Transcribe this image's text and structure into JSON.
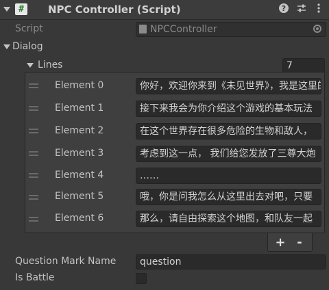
{
  "header": {
    "title": "NPC Controller (Script)",
    "script_icon_glyph": "#",
    "help_icon": "question-circle-icon",
    "preset_icon": "sliders-icon",
    "menu_icon": "kebab-menu-icon"
  },
  "script_field": {
    "label": "Script",
    "value": "NPCController"
  },
  "dialog": {
    "label": "Dialog",
    "lines": {
      "label": "Lines",
      "size": "7",
      "elements": [
        {
          "label": "Element 0",
          "value": "你好，欢迎你来到《未见世界》，我是这里的向导"
        },
        {
          "label": "Element 1",
          "value": "接下来我会为你介绍这个游戏的基本玩法"
        },
        {
          "label": "Element 2",
          "value": "在这个世界存在很多危险的生物和敌人，"
        },
        {
          "label": "Element 3",
          "value": "考虑到这一点， 我们给您发放了三尊大炮"
        },
        {
          "label": "Element 4",
          "value": "……"
        },
        {
          "label": "Element 5",
          "value": "哦，你是问我怎么从这里出去对吧，只要"
        },
        {
          "label": "Element 6",
          "value": "那么，请自由探索这个地图，和队友一起"
        }
      ],
      "add_label": "+",
      "remove_label": "-"
    }
  },
  "question_mark_name": {
    "label": "Question Mark Name",
    "value": "question"
  },
  "is_battle": {
    "label": "Is Battle",
    "checked": false
  },
  "colors": {
    "background": "#383838",
    "field": "#2a2a2a",
    "text": "#c4c4c4"
  }
}
